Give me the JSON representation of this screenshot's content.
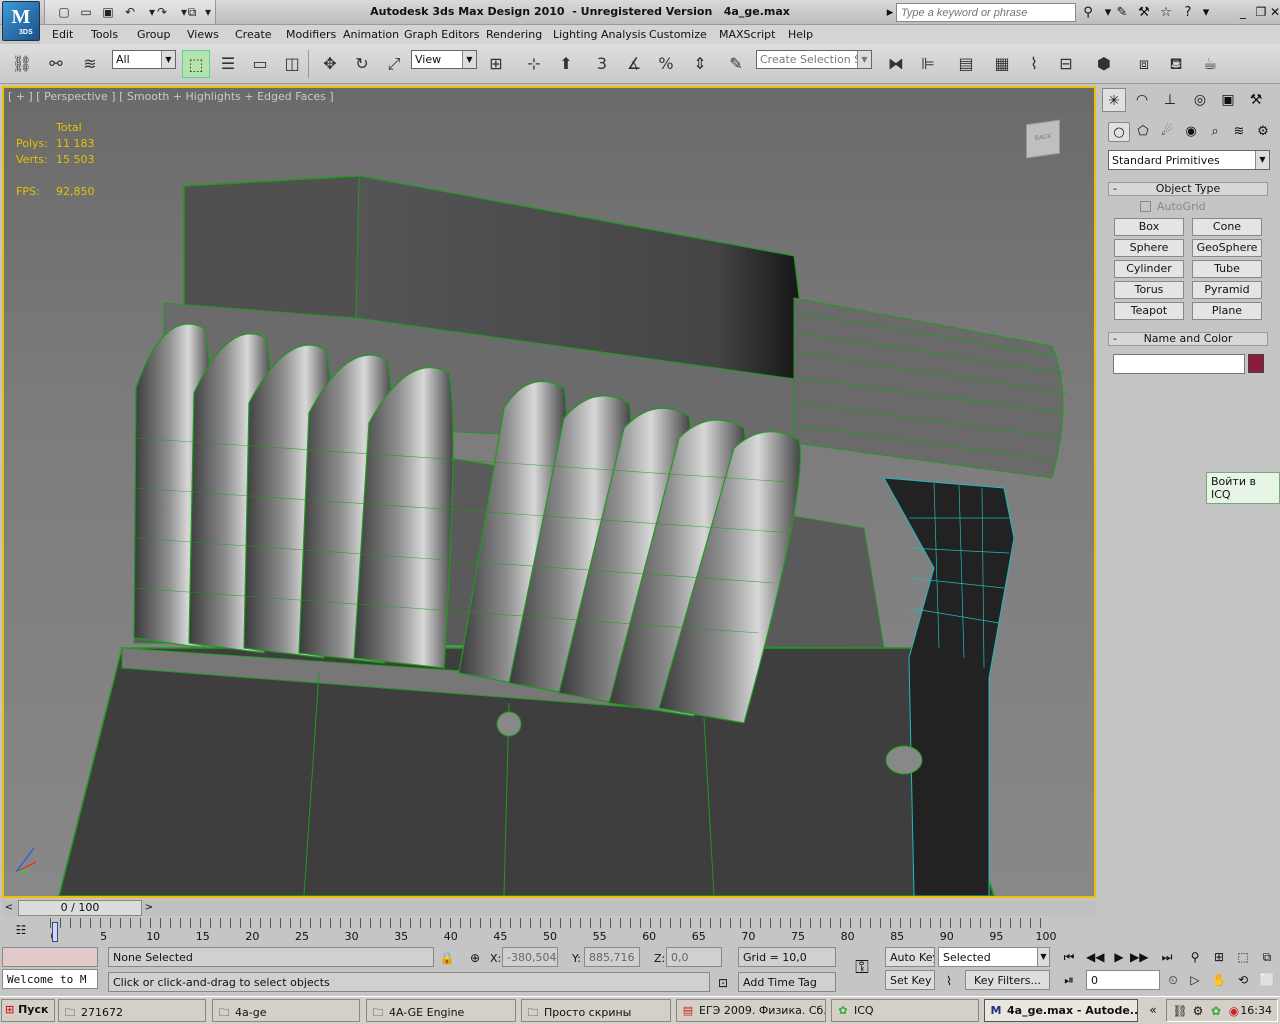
{
  "titlebar": {
    "title": "Autodesk 3ds Max Design 2010  - Unregistered Version   4a_ge.max",
    "search_placeholder": "Type a keyword or phrase",
    "logo_label": "3DS"
  },
  "menu": [
    "Edit",
    "Tools",
    "Group",
    "Views",
    "Create",
    "Modifiers",
    "Animation",
    "Graph Editors",
    "Rendering",
    "Lighting Analysis",
    "Customize",
    "MAXScript",
    "Help"
  ],
  "toolbar": {
    "selection_filter": "All",
    "reference_coord": "View",
    "named_selection_placeholder": "Create Selection Se",
    "snap_label": "3",
    "percent_label": "%"
  },
  "viewport": {
    "label": "[ + ] [ Perspective ] [ Smooth + Highlights + Edged Faces ]",
    "stats_header": "Total",
    "polys_label": "Polys:",
    "polys_value": "11 183",
    "verts_label": "Verts:",
    "verts_value": "15 503",
    "fps_label": "FPS:",
    "fps_value": "92,850",
    "viewcube_label": "BACK"
  },
  "command_panel": {
    "primitive_type": "Standard Primitives",
    "object_type_title": "Object Type",
    "autogrid_label": "AutoGrid",
    "buttons": [
      "Box",
      "Cone",
      "Sphere",
      "GeoSphere",
      "Cylinder",
      "Tube",
      "Torus",
      "Pyramid",
      "Teapot",
      "Plane"
    ],
    "name_color_title": "Name and Color",
    "color": "#8a1c3a"
  },
  "icq_tooltip": "Войти в ICQ",
  "timeline": {
    "slider_label": "0 / 100",
    "ticks": [
      "0",
      "5",
      "10",
      "15",
      "20",
      "25",
      "30",
      "35",
      "40",
      "45",
      "50",
      "55",
      "60",
      "65",
      "70",
      "75",
      "80",
      "85",
      "90",
      "95",
      "100"
    ]
  },
  "status": {
    "selection": "None Selected",
    "prompt": "Click or click-and-drag to select objects",
    "maxscript_listener": "Welcome to M",
    "x_label": "X:",
    "x_value": "-380,504",
    "y_label": "Y:",
    "y_value": "885,716",
    "z_label": "Z:",
    "z_value": "0,0",
    "grid": "Grid = 10,0",
    "add_time_tag": "Add Time Tag",
    "auto_key": "Auto Key",
    "set_key": "Set Key",
    "key_mode": "Selected",
    "key_filters": "Key Filters...",
    "frame_value": "0"
  },
  "taskbar": {
    "start": "Пуск",
    "tasks": [
      "271672",
      "4a-ge",
      "4A-GE Engine",
      "Просто скрины",
      "ЕГЭ 2009. Физика. Сб...",
      "ICQ",
      "4a_ge.max - Autode..."
    ],
    "clock": "16:34"
  },
  "colors": {
    "viewport_border": "#f0c000",
    "wire_color": "#1e9a1e",
    "stats_color": "#e6c200"
  }
}
